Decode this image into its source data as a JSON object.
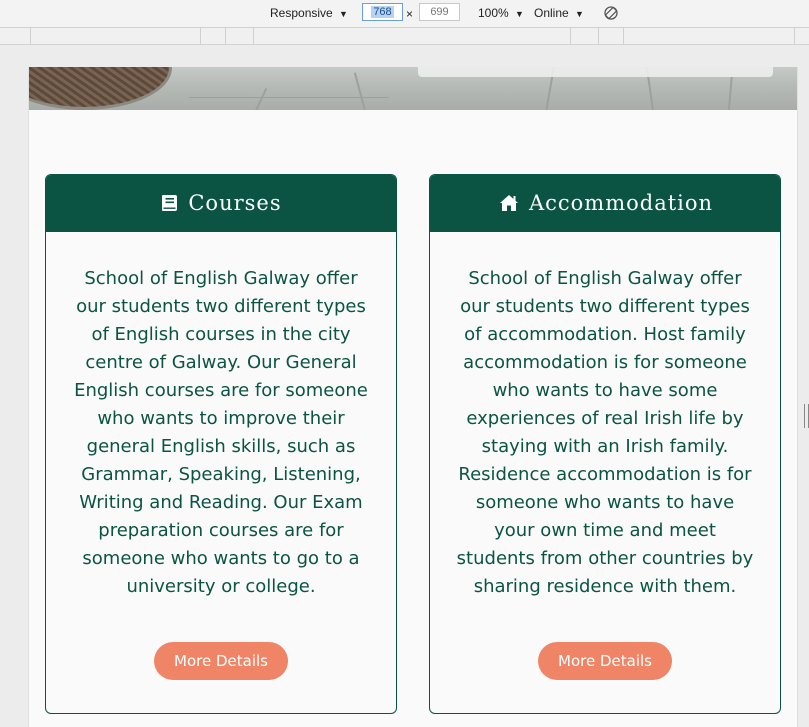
{
  "devtools": {
    "device_label": "Responsive",
    "width_value": "768",
    "times_symbol": "×",
    "height_value": "699",
    "zoom_label": "100%",
    "network_label": "Online",
    "dropdown_caret": "▼"
  },
  "cards": [
    {
      "title": "Courses",
      "icon": "book-icon",
      "body": "School of English Galway offer our students two different types of English courses in the city centre of Galway. Our General English courses are for someone who wants to improve their general English skills, such as Grammar, Speaking, Listening, Writing and Reading. Our Exam preparation courses are for someone who wants to go to a university or college.",
      "button": "More Details"
    },
    {
      "title": "Accommodation",
      "icon": "home-icon",
      "body": "School of English Galway offer our students two different types of accommodation. Host family accommodation is for someone who wants to have some experiences of real Irish life by staying with an Irish family. Residence accommodation is for someone who wants to have your own time and meet students from other countries by sharing residence with them.",
      "button": "More Details"
    }
  ],
  "colors": {
    "brand_green": "#0b5443",
    "button_coral": "#f08466",
    "page_background": "#fafafa"
  }
}
